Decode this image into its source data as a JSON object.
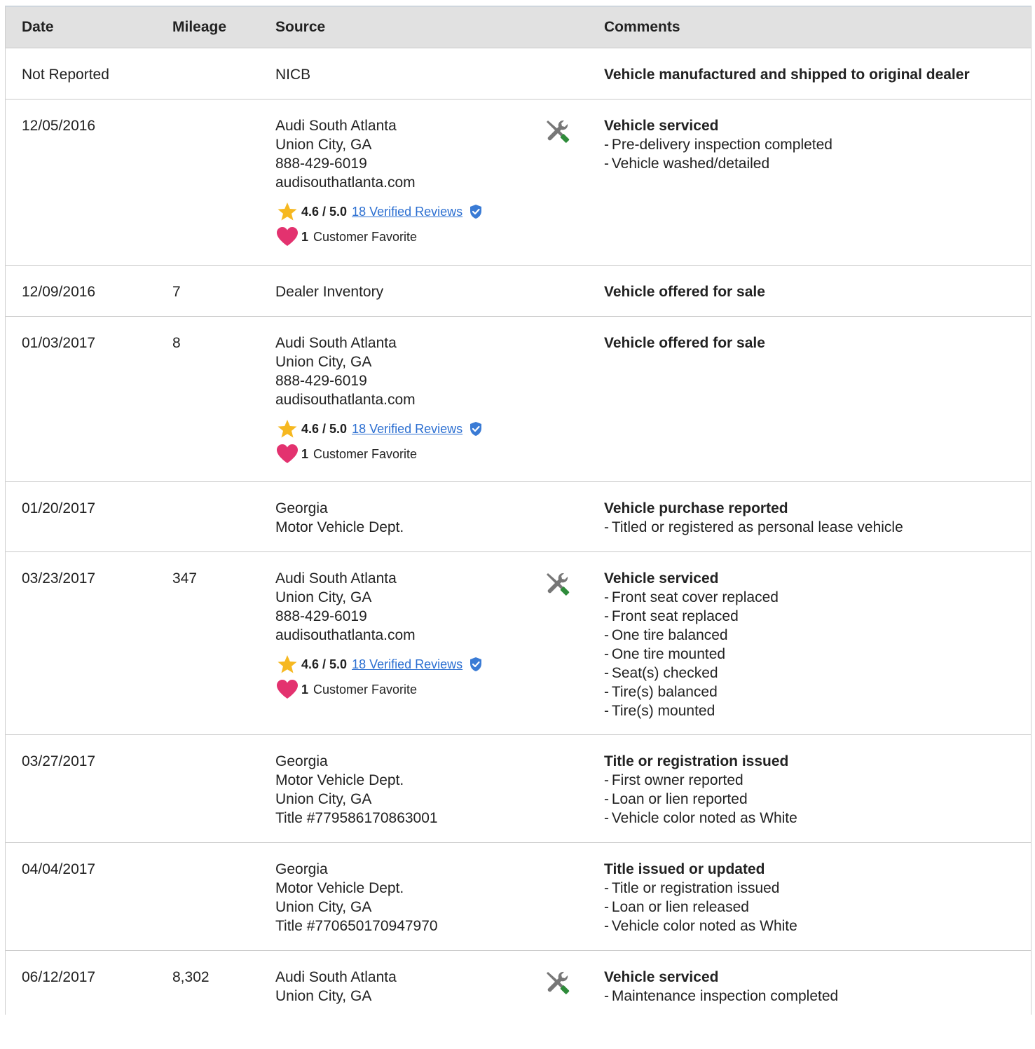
{
  "columns": {
    "date": "Date",
    "mileage": "Mileage",
    "source": "Source",
    "comments": "Comments"
  },
  "colors": {
    "star": "#f6b820",
    "heart": "#e3326f",
    "link": "#2c6fd1",
    "shield": "#3a7bd5",
    "wrench_handle": "#2e8b3a",
    "tool_gray": "#777777",
    "header_bg": "#e1e1e1"
  },
  "icons": {
    "service": "wrench-screwdriver-icon",
    "rating": "star-icon",
    "verified": "shield-check-icon",
    "favorite": "heart-icon"
  },
  "rows": [
    {
      "date": "Not Reported",
      "mileage": "",
      "source": [
        "NICB"
      ],
      "comment_head": "Vehicle manufactured and shipped to original dealer",
      "comment_items": []
    },
    {
      "date": "12/05/2016",
      "mileage": "",
      "source": [
        "Audi South Atlanta",
        "Union City, GA",
        "888-429-6019",
        "audisouthatlanta.com"
      ],
      "rating": "4.6 / 5.0",
      "reviews": "18 Verified Reviews",
      "favorites": "1",
      "favorites_label": "Customer Favorite",
      "comment_head": "Vehicle serviced",
      "comment_items": [
        "Pre-delivery inspection completed",
        "Vehicle washed/detailed"
      ]
    },
    {
      "date": "12/09/2016",
      "mileage": "7",
      "source": [
        "Dealer Inventory"
      ],
      "comment_head": "Vehicle offered for sale",
      "comment_items": []
    },
    {
      "date": "01/03/2017",
      "mileage": "8",
      "source": [
        "Audi South Atlanta",
        "Union City, GA",
        "888-429-6019",
        "audisouthatlanta.com"
      ],
      "rating": "4.6 / 5.0",
      "reviews": "18 Verified Reviews",
      "favorites": "1",
      "favorites_label": "Customer Favorite",
      "comment_head": "Vehicle offered for sale",
      "comment_items": []
    },
    {
      "date": "01/20/2017",
      "mileage": "",
      "source": [
        "Georgia",
        "Motor Vehicle Dept."
      ],
      "comment_head": "Vehicle purchase reported",
      "comment_items": [
        "Titled or registered as personal lease vehicle"
      ]
    },
    {
      "date": "03/23/2017",
      "mileage": "347",
      "source": [
        "Audi South Atlanta",
        "Union City, GA",
        "888-429-6019",
        "audisouthatlanta.com"
      ],
      "rating": "4.6 / 5.0",
      "reviews": "18 Verified Reviews",
      "favorites": "1",
      "favorites_label": "Customer Favorite",
      "comment_head": "Vehicle serviced",
      "comment_items": [
        "Front seat cover replaced",
        "Front seat replaced",
        "One tire balanced",
        "One tire mounted",
        "Seat(s) checked",
        "Tire(s) balanced",
        "Tire(s) mounted"
      ]
    },
    {
      "date": "03/27/2017",
      "mileage": "",
      "source": [
        "Georgia",
        "Motor Vehicle Dept.",
        "Union City, GA",
        "Title #779586170863001"
      ],
      "comment_head": "Title or registration issued",
      "comment_items": [
        "First owner reported",
        "Loan or lien reported",
        "Vehicle color noted as White"
      ]
    },
    {
      "date": "04/04/2017",
      "mileage": "",
      "source": [
        "Georgia",
        "Motor Vehicle Dept.",
        "Union City, GA",
        "Title #770650170947970"
      ],
      "comment_head": "Title issued or updated",
      "comment_items": [
        "Title or registration issued",
        "Loan or lien released",
        "Vehicle color noted as White"
      ]
    },
    {
      "date": "06/12/2017",
      "mileage": "8,302",
      "source": [
        "Audi South Atlanta",
        "Union City, GA"
      ],
      "comment_head": "Vehicle serviced",
      "comment_items": [
        "Maintenance inspection completed"
      ]
    }
  ]
}
